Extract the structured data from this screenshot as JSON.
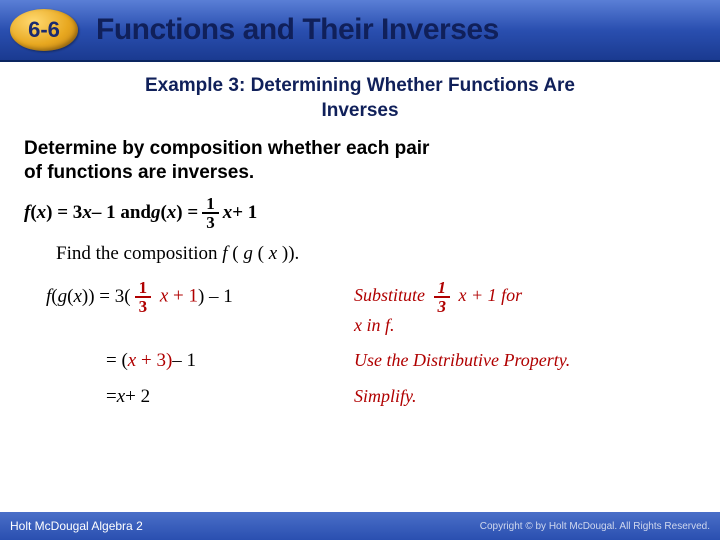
{
  "header": {
    "badge": "6-6",
    "title": "Functions and Their Inverses"
  },
  "example_title_l1": "Example 3: Determining Whether Functions Are",
  "example_title_l2": "Inverses",
  "instruction_l1": "Determine by composition whether each pair",
  "instruction_l2": "of functions are inverses.",
  "func": {
    "p1": "f",
    "p2": "(",
    "p3": "x",
    "p4": ") = 3",
    "p5": "x",
    "p6": " – 1 and ",
    "p7": "g",
    "p8": "(",
    "p9": "x",
    "p10": ") = ",
    "frac_num": "1",
    "frac_den": "3",
    "p11": "x",
    "p12": " + 1"
  },
  "find": {
    "p1": "Find the composition ",
    "p2": "f",
    "p3": "(",
    "p4": "g",
    "p5": "(",
    "p6": "x",
    "p7": "))."
  },
  "row1": {
    "m1": "f",
    "m2": "(",
    "m3": "g",
    "m4": "(",
    "m5": "x",
    "m6": ")) = 3(",
    "frac_num": "1",
    "frac_den": "3",
    "m7": "x",
    "m8": " + 1",
    "m9": ") – 1",
    "n1": "Substitute ",
    "nfn": "1",
    "nfd": "3",
    "n2": " x + 1 for",
    "n3": "x in f."
  },
  "row2": {
    "m1": "= (",
    "m2": "x",
    "m3": " + 3)",
    "m4": " – 1",
    "n": "Use the Distributive Property."
  },
  "row3": {
    "m1": "= ",
    "m2": "x",
    "m3": " + 2",
    "n": "Simplify."
  },
  "footer": {
    "book": "Holt McDougal Algebra 2",
    "copy": "Copyright © by Holt McDougal. All Rights Reserved."
  }
}
